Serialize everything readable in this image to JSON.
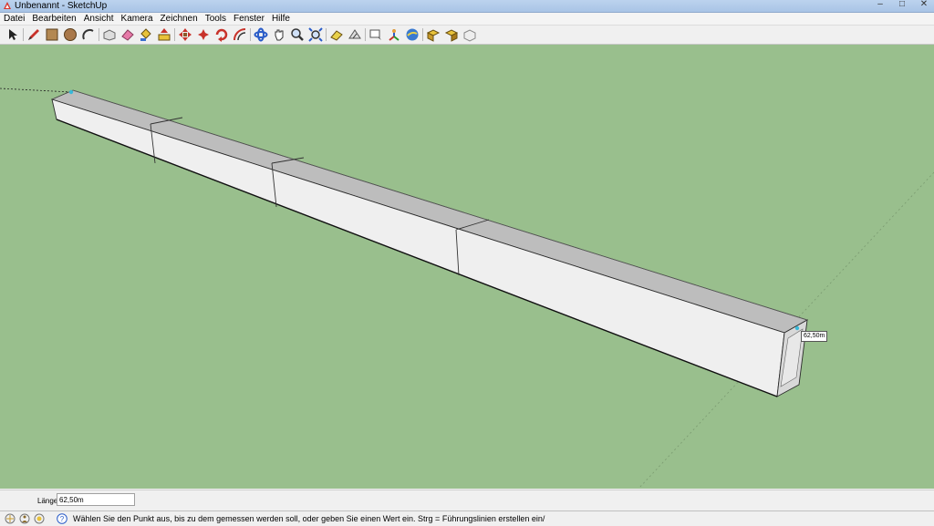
{
  "window": {
    "title": "Unbenannt - SketchUp"
  },
  "menu": [
    "Datei",
    "Bearbeiten",
    "Ansicht",
    "Kamera",
    "Zeichnen",
    "Tools",
    "Fenster",
    "Hilfe"
  ],
  "toolbar": {
    "tools": [
      "select-icon",
      "pencil-icon",
      "rectangle-icon",
      "circle-icon",
      "arc-icon",
      "make-component-icon",
      "eraser-icon",
      "paint-bucket-icon",
      "push-pull-icon",
      "move-icon",
      "rotate-icon",
      "follow-me-icon",
      "offset-icon",
      "orbit-icon",
      "pan-icon",
      "zoom-icon",
      "zoom-extents-icon",
      "dimension-icon",
      "protractor-icon",
      "text-icon",
      "axes-icon",
      "google-earth-icon",
      "get-models-icon",
      "share-model-icon",
      "components-icon"
    ]
  },
  "viewport": {
    "background_color": "#99bf8d",
    "tooltip": "62,50m"
  },
  "measurements": {
    "label": "Länge",
    "value": "62,50m"
  },
  "status": {
    "message": "Wählen Sie den Punkt aus, bis zu dem gemessen werden soll, oder geben Sie einen Wert ein.  Strg = Führungslinien erstellen ein/"
  }
}
